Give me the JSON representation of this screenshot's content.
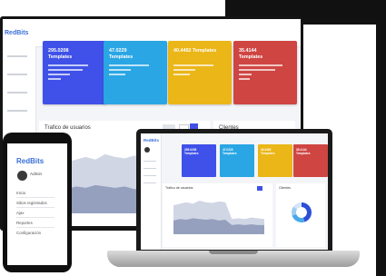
{
  "colors": {
    "blue": "#3f51e8",
    "teal": "#2aa6e4",
    "yellow": "#ebb618",
    "red": "#cf4542",
    "brand": "#3a6fd8"
  },
  "brand": {
    "logo_text": "RedBits"
  },
  "monitor": {
    "cards": [
      {
        "value": "295.0208",
        "label": "Templates",
        "color": "#3f51e8"
      },
      {
        "value": "47.0229",
        "label": "Templates",
        "color": "#2aa6e4"
      },
      {
        "value": "40.4492 Templates",
        "label": "",
        "color": "#ebb618"
      },
      {
        "value": "35.4144",
        "label": "Templates",
        "color": "#cf4542"
      }
    ],
    "chart_title": "Trafico de usuarios",
    "clients_title": "Clientes"
  },
  "laptop": {
    "cards": [
      {
        "value": "295.0208",
        "label": "Templates",
        "color": "#3f51e8"
      },
      {
        "value": "47.0229",
        "label": "Templates",
        "color": "#2aa6e4"
      },
      {
        "value": "40.4492",
        "label": "Templates",
        "color": "#ebb618"
      },
      {
        "value": "35.4144",
        "label": "Templates",
        "color": "#cf4542"
      }
    ],
    "chart_title": "Trafico de usuarios",
    "clients_title": "Clientes"
  },
  "phone": {
    "logo": "RedBits",
    "user": "Admin",
    "menu": [
      "Inicio",
      "Sitios registrados",
      "Ajax",
      "Reportes",
      "Configuración"
    ]
  },
  "chart_data": {
    "type": "area",
    "title": "Trafico de usuarios",
    "series": [
      {
        "values": [
          38,
          40,
          42,
          40,
          44,
          42,
          41,
          43,
          42,
          20,
          21,
          20,
          22,
          21,
          20
        ]
      },
      {
        "values": [
          18,
          20,
          19,
          21,
          20,
          19,
          20,
          18,
          19,
          12,
          13,
          12,
          13,
          12,
          12
        ]
      }
    ],
    "ylim": [
      0,
      50
    ]
  },
  "donut": {
    "slices": [
      45,
      25,
      15,
      15
    ],
    "colors": [
      "#2c4fd8",
      "#4aa8e8",
      "#9ecbf0",
      "#d5e6f8"
    ]
  }
}
